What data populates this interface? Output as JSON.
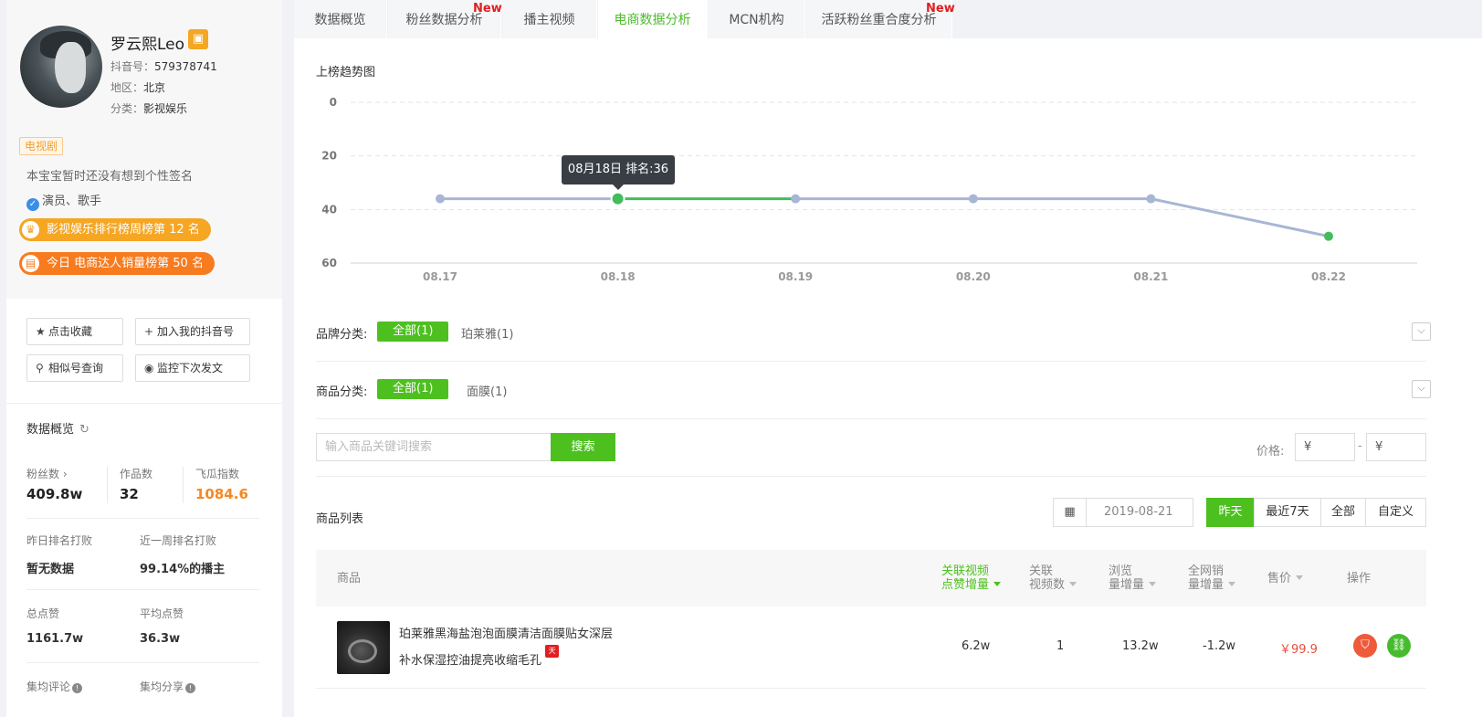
{
  "profile": {
    "nickname": "罗云熙Leo",
    "douyin_id_label": "抖音号：",
    "douyin_id": "579378741",
    "region_label": "地区：",
    "region": "北京",
    "category_label": "分类：",
    "category": "影视娱乐",
    "tag": "电视剧",
    "signature": "本宝宝暂时还没有想到个性签名",
    "verification": "演员、歌手",
    "rank_badges": [
      {
        "text": "影视娱乐排行榜周榜第 12 名"
      },
      {
        "text": "今日 电商达人销量榜第 50 名"
      }
    ]
  },
  "actions": {
    "favorite": "点击收藏",
    "add_account": "加入我的抖音号",
    "similar": "相似号查询",
    "monitor": "监控下次发文"
  },
  "overview": {
    "title": "数据概览",
    "stats": [
      {
        "label": "粉丝数 ›",
        "value": "409.8w"
      },
      {
        "label": "作品数",
        "value": "32"
      },
      {
        "label": "飞瓜指数",
        "value": "1084.6"
      }
    ],
    "beat_yesterday_label": "昨日排名打败",
    "beat_yesterday_value": "暂无数据",
    "beat_week_label": "近一周排名打败",
    "beat_week_value": "99.14%的播主",
    "total_likes_label": "总点赞",
    "total_likes_value": "1161.7w",
    "avg_likes_label": "平均点赞",
    "avg_likes_value": "36.3w",
    "avg_comments_label": "集均评论",
    "avg_shares_label": "集均分享"
  },
  "tabs": [
    {
      "label": "数据概览",
      "new": ""
    },
    {
      "label": "粉丝数据分析",
      "new": "New"
    },
    {
      "label": "播主视频",
      "new": ""
    },
    {
      "label": "电商数据分析",
      "new": ""
    },
    {
      "label": "MCN机构",
      "new": ""
    },
    {
      "label": "活跃粉丝重合度分析",
      "new": "New"
    }
  ],
  "chart_data": {
    "type": "line",
    "title": "上榜趋势图",
    "x": [
      "08.17",
      "08.18",
      "08.19",
      "08.20",
      "08.21",
      "08.22"
    ],
    "series": [
      {
        "values": [
          36,
          36,
          36,
          36,
          36,
          50
        ]
      }
    ],
    "ylim": [
      0,
      60
    ],
    "y_inverted": true,
    "yticks": [
      0,
      20,
      40,
      60
    ],
    "highlight_index": 1,
    "tooltip": "08月18日 排名:36",
    "colors": {
      "line": "#a8b6d4",
      "highlight": "#43bd5c"
    }
  },
  "filters": {
    "brand_label": "品牌分类:",
    "brand_all": "全部(1)",
    "brand_option": "珀莱雅(1)",
    "product_label": "商品分类:",
    "product_all": "全部(1)",
    "product_option": "面膜(1)"
  },
  "search": {
    "placeholder": "输入商品关键词搜索",
    "button": "搜索",
    "price_label": "价格:",
    "price_min": "¥",
    "price_max": "¥",
    "dash": "-"
  },
  "product_list": {
    "title": "商品列表",
    "date": "2019-08-21",
    "ranges": [
      "昨天",
      "最近7天",
      "全部",
      "自定义"
    ],
    "columns": {
      "product": "商品",
      "video_likes_1": "关联视频",
      "video_likes_2": "点赞增量",
      "video_count_1": "关联",
      "video_count_2": "视频数",
      "views_1": "浏览",
      "views_2": "量增量",
      "sales_1": "全网销",
      "sales_2": "量增量",
      "price": "售价",
      "ops": "操作"
    },
    "rows": [
      {
        "name": "珀莱雅黑海盐泡泡面膜清洁面膜贴女深层补水保湿控油提亮收缩毛孔",
        "shop_tag": "天猫",
        "video_likes": "6.2w",
        "video_count": "1",
        "views": "13.2w",
        "sales": "-1.2w",
        "price": "￥99.9"
      }
    ]
  },
  "colors": {
    "accent": "#4dc01f",
    "orange": "#f7871f",
    "price": "#e8503a"
  }
}
